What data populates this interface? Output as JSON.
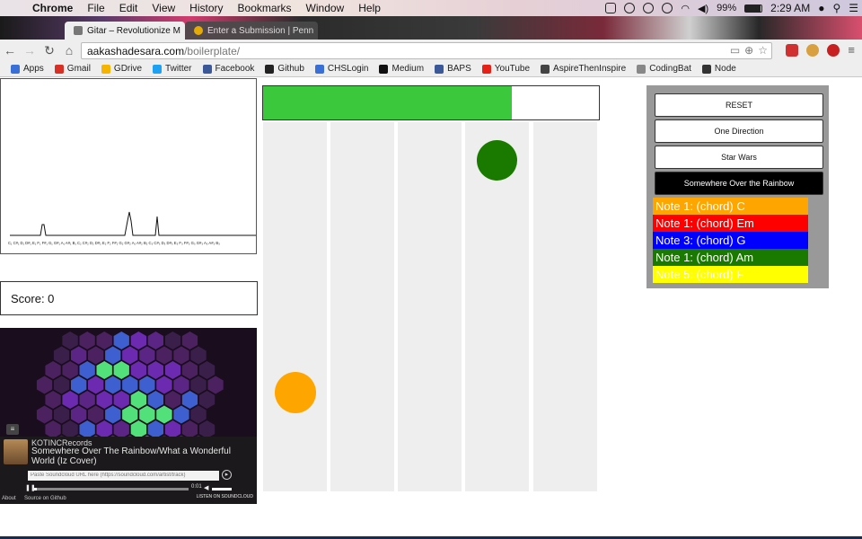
{
  "menubar": {
    "app": "Chrome",
    "items": [
      "File",
      "Edit",
      "View",
      "History",
      "Bookmarks",
      "Window",
      "Help"
    ],
    "battery": "99%",
    "clock": "2:29 AM"
  },
  "tabs": [
    {
      "title": "Gitar – Revolutionize M",
      "active": true
    },
    {
      "title": "Enter a Submission | Penn",
      "active": false
    }
  ],
  "address": {
    "host": "aakashadesara.com",
    "path": "/boilerplate/"
  },
  "bookmarks": [
    {
      "label": "Apps",
      "color": "#3b6fd8"
    },
    {
      "label": "Gmail",
      "color": "#d93025"
    },
    {
      "label": "GDrive",
      "color": "#f4b400"
    },
    {
      "label": "Twitter",
      "color": "#1da1f2"
    },
    {
      "label": "Facebook",
      "color": "#3b5998"
    },
    {
      "label": "Github",
      "color": "#222222"
    },
    {
      "label": "CHSLogin",
      "color": "#3b6fd8"
    },
    {
      "label": "Medium",
      "color": "#111111"
    },
    {
      "label": "BAPS",
      "color": "#3b5998"
    },
    {
      "label": "YouTube",
      "color": "#e62117"
    },
    {
      "label": "AspireThenInspire",
      "color": "#444444"
    },
    {
      "label": "CodingBat",
      "color": "#888888"
    },
    {
      "label": "Node",
      "color": "#333333"
    }
  ],
  "spectrum": {
    "tick_labels": "C₁ C#₁ D₁ D#₁ E₁ F₁ F#₁ G₁ G#₁ A₁ A#₁ B₁ C₂ C#₂ D₂ D#₂ E₂ F₂ F#₂ G₂ G#₂ A₂ A#₂ B₂ C₃ C#₃ D₃ D#₃ E₃ F₃ F#₃ G₃ G#₃ A₃ A#₃ B₃"
  },
  "score": {
    "label": "Score: 0"
  },
  "player": {
    "artist": "KOTINCRecords",
    "track": "Somewhere Over The Rainbow/What a Wonderful World (Iz Cover)",
    "url_placeholder": "Paste Soundcloud URL here (https://soundcloud.com/artist/track)",
    "time": "0:01",
    "about": "About",
    "source": "Source on Github",
    "badge": "LISTEN ON SOUNDCLOUD"
  },
  "game": {
    "progress": 0.74,
    "progress_color": "#3cc83c",
    "lane_count": 5
  },
  "panel": {
    "buttons": [
      {
        "label": "RESET",
        "active": false
      },
      {
        "label": "One Direction",
        "active": false
      },
      {
        "label": "Star Wars",
        "active": false
      },
      {
        "label": "Somewhere Over the Rainbow",
        "active": true
      }
    ],
    "notes": [
      {
        "label": "Note 1: (chord) C",
        "color": "#ffa500"
      },
      {
        "label": "Note 1: (chord) Em",
        "color": "#ff0000"
      },
      {
        "label": "Note 3: (chord) G",
        "color": "#0000ff"
      },
      {
        "label": "Note 1: (chord) Am",
        "color": "#1a7a00"
      },
      {
        "label": "Note 5: (chord) F",
        "color": "#ffff00"
      }
    ]
  },
  "orbs": [
    {
      "lane": 0,
      "color": "#ffa500"
    },
    {
      "lane": 3,
      "color": "#1a7a00"
    }
  ]
}
